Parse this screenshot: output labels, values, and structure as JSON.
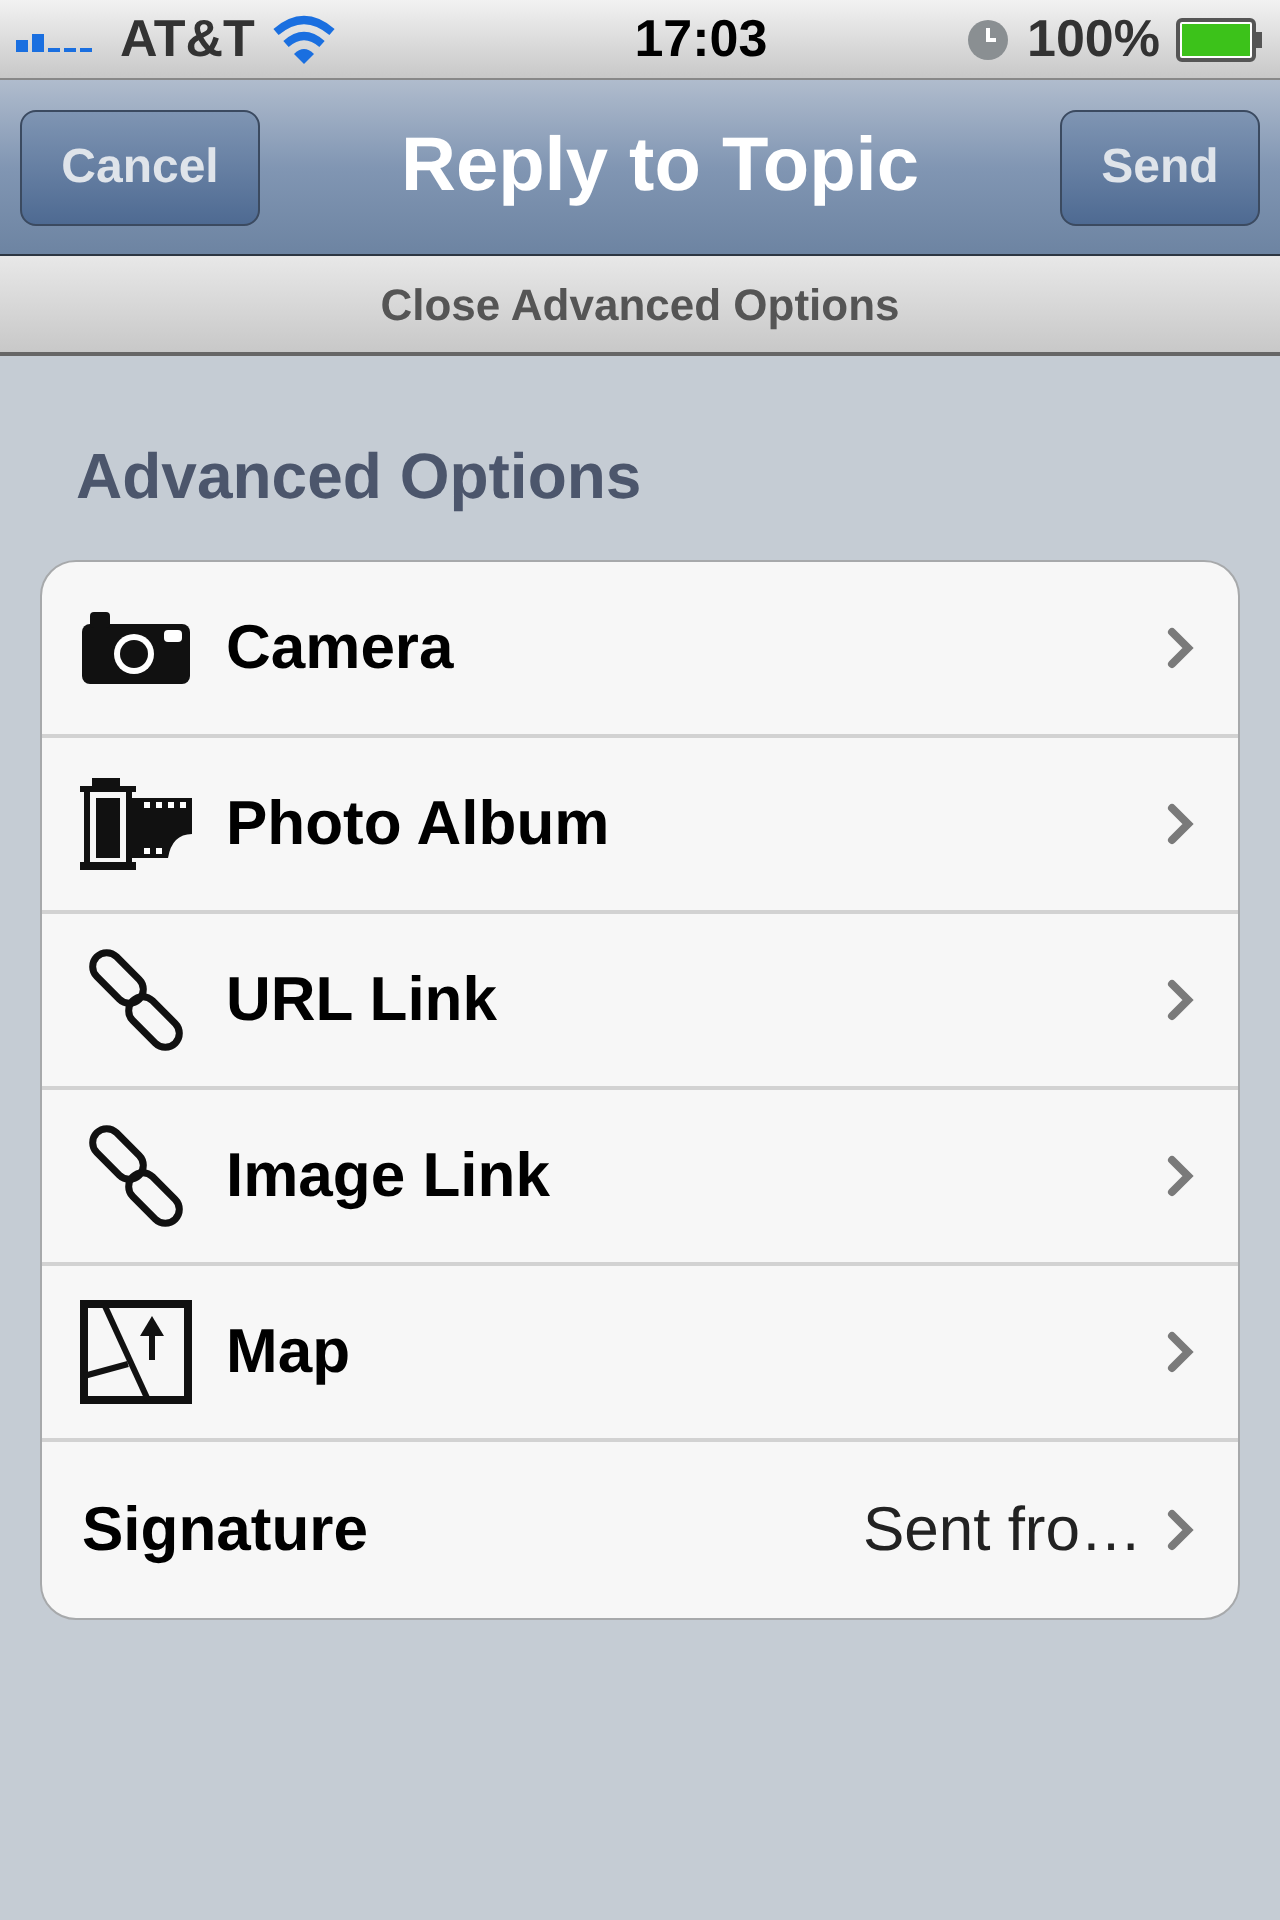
{
  "status_bar": {
    "carrier": "AT&T",
    "time": "17:03",
    "battery": "100%"
  },
  "nav_bar": {
    "title": "Reply to Topic",
    "left_button": "Cancel",
    "right_button": "Send"
  },
  "toggle_bar": {
    "label": "Close Advanced Options"
  },
  "section": {
    "heading": "Advanced Options"
  },
  "rows": [
    {
      "kind": "camera",
      "label": "Camera"
    },
    {
      "kind": "film",
      "label": "Photo Album"
    },
    {
      "kind": "link",
      "label": "URL Link"
    },
    {
      "kind": "link",
      "label": "Image Link"
    },
    {
      "kind": "map",
      "label": "Map"
    },
    {
      "kind": "plain",
      "label": "Signature",
      "value": "Sent fro…"
    }
  ]
}
